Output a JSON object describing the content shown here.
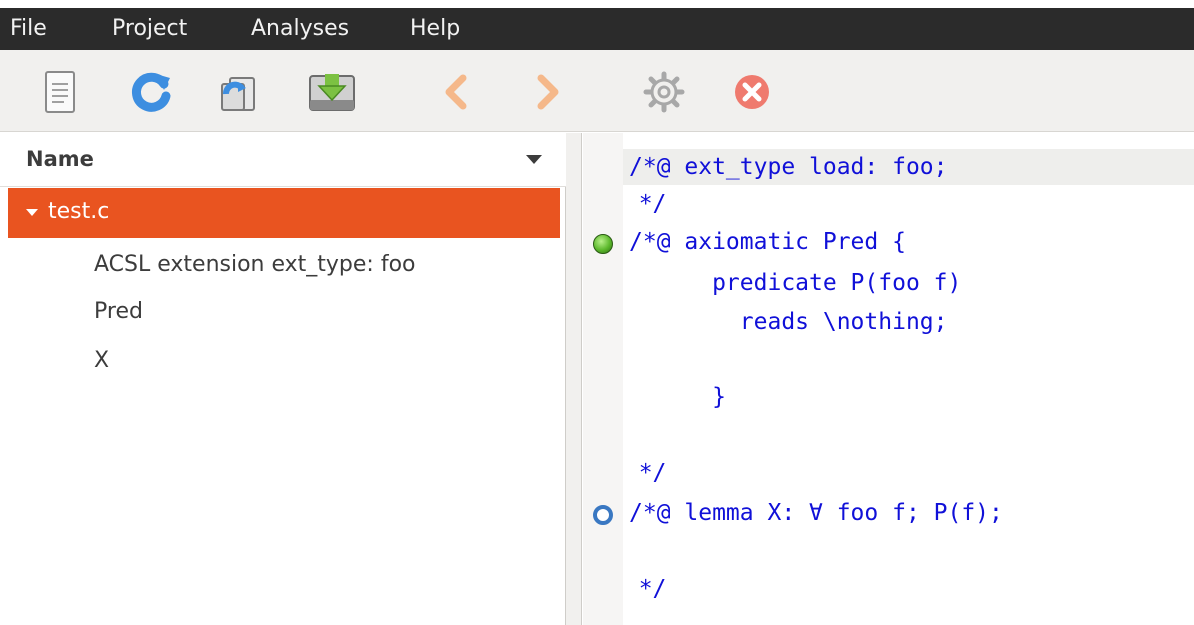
{
  "menu": {
    "items": [
      "File",
      "Project",
      "Analyses",
      "Help"
    ]
  },
  "toolbar": {
    "buttons": [
      "new-file-icon",
      "reload-icon",
      "copy-icon",
      "save-icon",
      "back-icon",
      "forward-icon",
      "settings-icon",
      "stop-icon"
    ]
  },
  "tree": {
    "column_title": "Name",
    "file": "test.c",
    "items": [
      "ACSL extension ext_type: foo",
      "Pred",
      "X"
    ]
  },
  "colors": {
    "selection": "#e95420",
    "code": "#1010d8",
    "status_valid": "#5cb82c",
    "status_unknown": "#3a78c2"
  },
  "code": {
    "lines": [
      "/*@ ext_type load: foo;",
      "  */",
      "/*@ axiomatic Pred {",
      "      predicate P(foo f)",
      "        reads \\nothing;",
      "",
      "      }",
      "",
      "  */",
      "/*@ lemma X: ∀ foo f; P(f);",
      "",
      "  */"
    ]
  }
}
